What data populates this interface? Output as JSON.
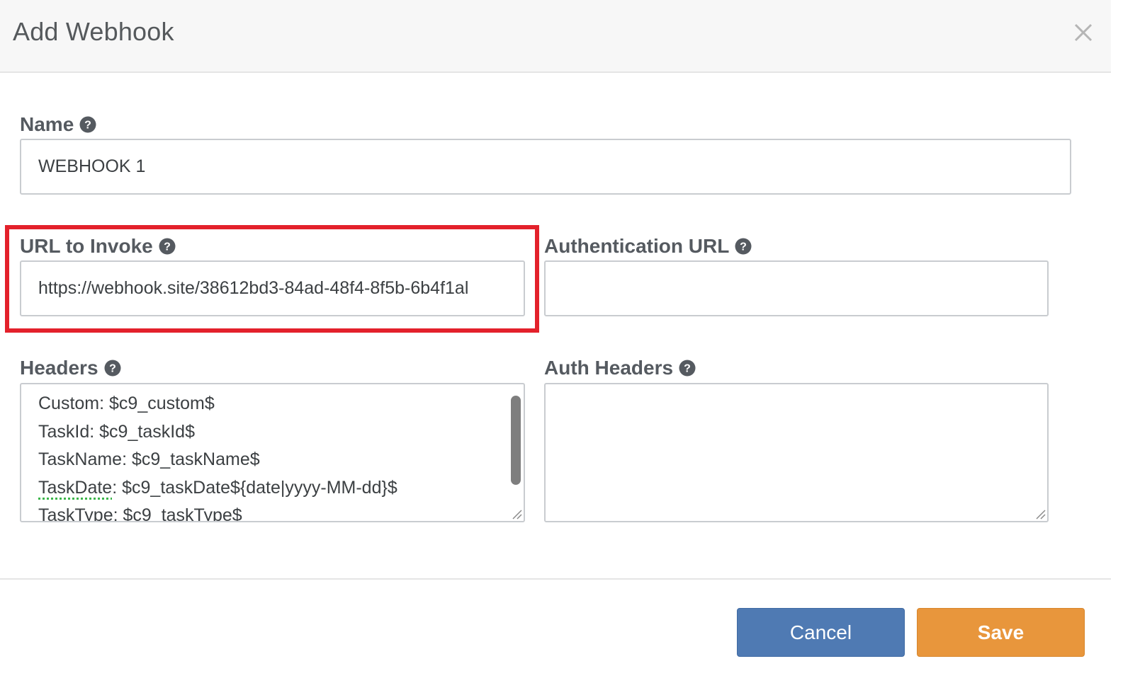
{
  "dialog": {
    "title": "Add Webhook",
    "close_icon": "close-icon"
  },
  "form": {
    "name": {
      "label": "Name",
      "value": "WEBHOOK 1",
      "help_icon": "question-circle-icon"
    },
    "url_to_invoke": {
      "label": "URL to Invoke",
      "value": "https://webhook.site/38612bd3-84ad-48f4-8f5b-6b4f1al",
      "help_icon": "question-circle-icon"
    },
    "authentication_url": {
      "label": "Authentication URL",
      "value": "",
      "help_icon": "question-circle-icon"
    },
    "headers": {
      "label": "Headers",
      "help_icon": "question-circle-icon",
      "lines": [
        {
          "key": "Custom",
          "value": ": $c9_custom$"
        },
        {
          "key": "TaskId",
          "value": ": $c9_taskId$"
        },
        {
          "key": "TaskName",
          "value": ": $c9_taskName$"
        },
        {
          "key": "TaskDate",
          "value": ": $c9_taskDate${date|yyyy-MM-dd}$"
        },
        {
          "key": "TaskType",
          "value": ": $c9_taskType$"
        }
      ]
    },
    "auth_headers": {
      "label": "Auth Headers",
      "value": "",
      "help_icon": "question-circle-icon"
    }
  },
  "footer": {
    "cancel_label": "Cancel",
    "save_label": "Save"
  },
  "colors": {
    "highlight": "#e3212b",
    "cancel_button": "#4f7ab3",
    "save_button": "#e8963c"
  }
}
